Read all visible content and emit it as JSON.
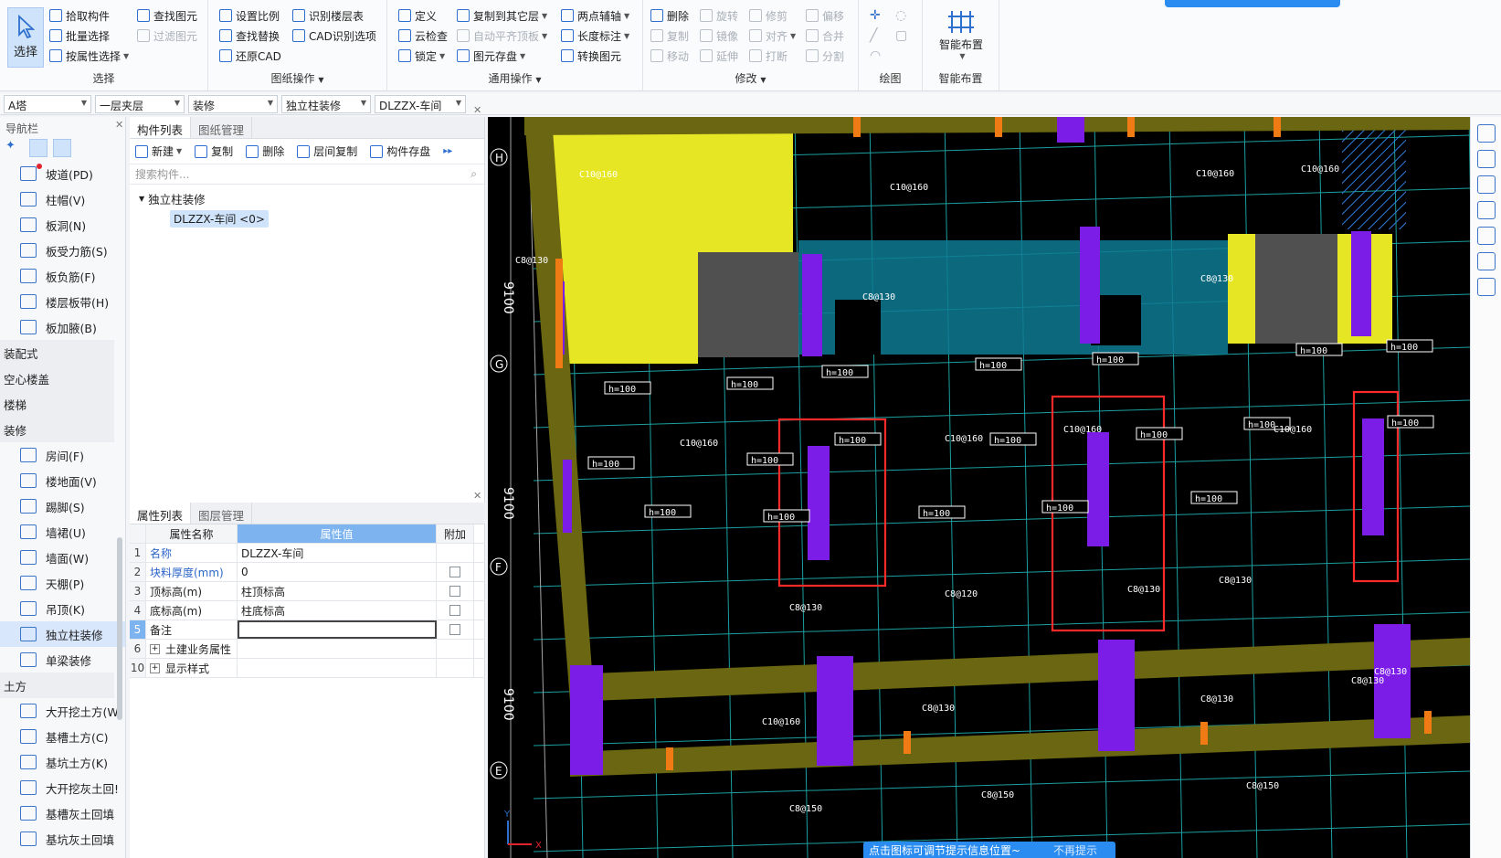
{
  "ribbon": {
    "select_group": {
      "big_select": "选择",
      "pick": "拾取构件",
      "batch": "批量选择",
      "by_attr": "按属性选择",
      "find": "查找图元",
      "filter": "过滤图元",
      "title": "选择"
    },
    "drawing_group": {
      "set_scale": "设置比例",
      "find_replace": "查找替换",
      "restore_cad": "还原CAD",
      "identify_floor": "识别楼层表",
      "cad_options": "CAD识别选项",
      "title": "图纸操作"
    },
    "general_group": {
      "define": "定义",
      "cloud_check": "云检查",
      "lock": "锁定",
      "copy_to_other": "复制到其它层",
      "auto_align": "自动平齐顶板",
      "store": "图元存盘",
      "two_point_axis": "两点辅轴",
      "length_mark": "长度标注",
      "convert": "转换图元",
      "title": "通用操作"
    },
    "modify_group": {
      "delete": "删除",
      "copy": "复制",
      "move": "移动",
      "rotate": "旋转",
      "mirror": "镜像",
      "extend": "延伸",
      "trim": "修剪",
      "align": "对齐",
      "break": "打断",
      "offset": "偏移",
      "merge": "合并",
      "split": "分割",
      "title": "修改"
    },
    "draw_group": {
      "title": "绘图"
    },
    "smart_group": {
      "smart_layout": "智能布置",
      "title": "智能布置"
    }
  },
  "selectors": [
    "A塔",
    "一层夹层",
    "装修",
    "独立柱装修",
    "DLZZX-车间"
  ],
  "nav": {
    "title": "导航栏",
    "items_a": [
      {
        "label": "坡道(PD)",
        "icon": "ramp-icon"
      },
      {
        "label": "柱帽(V)",
        "icon": "column-cap-icon"
      },
      {
        "label": "板洞(N)",
        "icon": "slab-hole-icon"
      },
      {
        "label": "板受力筋(S)",
        "icon": "slab-rebar-icon"
      },
      {
        "label": "板负筋(F)",
        "icon": "negative-rebar-icon"
      },
      {
        "label": "楼层板带(H)",
        "icon": "slab-strip-icon"
      },
      {
        "label": "板加腋(B)",
        "icon": "haunch-icon"
      }
    ],
    "cat_prefab": "装配式",
    "cat_hollow": "空心楼盖",
    "cat_stairs": "楼梯",
    "cat_decor": "装修",
    "items_b": [
      {
        "label": "房间(F)",
        "icon": "room-icon"
      },
      {
        "label": "楼地面(V)",
        "icon": "floor-icon"
      },
      {
        "label": "踢脚(S)",
        "icon": "skirting-icon"
      },
      {
        "label": "墙裙(U)",
        "icon": "dado-icon"
      },
      {
        "label": "墙面(W)",
        "icon": "wall-face-icon"
      },
      {
        "label": "天棚(P)",
        "icon": "ceiling-icon"
      },
      {
        "label": "吊顶(K)",
        "icon": "suspended-ceiling-icon"
      },
      {
        "label": "独立柱装修",
        "icon": "column-finish-icon"
      },
      {
        "label": "单梁装修",
        "icon": "beam-finish-icon"
      }
    ],
    "cat_earth": "土方",
    "items_c": [
      {
        "label": "大开挖土方(W",
        "icon": "excavation-icon"
      },
      {
        "label": "基槽土方(C)",
        "icon": "trench-icon"
      },
      {
        "label": "基坑土方(K)",
        "icon": "pit-icon"
      },
      {
        "label": "大开挖灰土回!",
        "icon": "lime-fill-icon"
      },
      {
        "label": "基槽灰土回填",
        "icon": "trench-fill-icon"
      },
      {
        "label": "基坑灰土回填",
        "icon": "pit-fill-icon"
      }
    ]
  },
  "component_panel": {
    "tab_list": "构件列表",
    "tab_drawing": "图纸管理",
    "new": "新建",
    "copy": "复制",
    "delete": "删除",
    "floor_copy": "层间复制",
    "store": "构件存盘",
    "search_placeholder": "搜索构件...",
    "tree_root": "独立柱装修",
    "tree_leaf": "DLZZX-车间 <0>"
  },
  "property_panel": {
    "tab_props": "属性列表",
    "tab_layers": "图层管理",
    "col_name": "属性名称",
    "col_value": "属性值",
    "col_extra": "附加",
    "rows": [
      {
        "n": "1",
        "name": "名称",
        "value": "DLZZX-车间",
        "blue": true,
        "check": false
      },
      {
        "n": "2",
        "name": "块料厚度(mm)",
        "value": "0",
        "blue": true,
        "check": true
      },
      {
        "n": "3",
        "name": "顶标高(m)",
        "value": "柱顶标高",
        "blue": false,
        "check": true
      },
      {
        "n": "4",
        "name": "底标高(m)",
        "value": "柱底标高",
        "blue": false,
        "check": true
      },
      {
        "n": "5",
        "name": "备注",
        "value": "",
        "blue": false,
        "check": true
      },
      {
        "n": "6",
        "name": "土建业务属性",
        "value": "",
        "blue": false,
        "check": false
      },
      {
        "n": "10",
        "name": "显示样式",
        "value": "",
        "blue": false,
        "check": false
      }
    ]
  },
  "cad": {
    "axis_labels": [
      "H",
      "G",
      "F",
      "E"
    ],
    "dim_labels": [
      "9100",
      "9100",
      "9100"
    ],
    "h_labels": [
      "h=100"
    ],
    "rebar_labels": [
      "C10@160",
      "C8@130",
      "C8@120",
      "C8@150"
    ]
  },
  "hint": {
    "text": "点击图标可调节提示信息位置~",
    "dismiss": "不再提示"
  }
}
